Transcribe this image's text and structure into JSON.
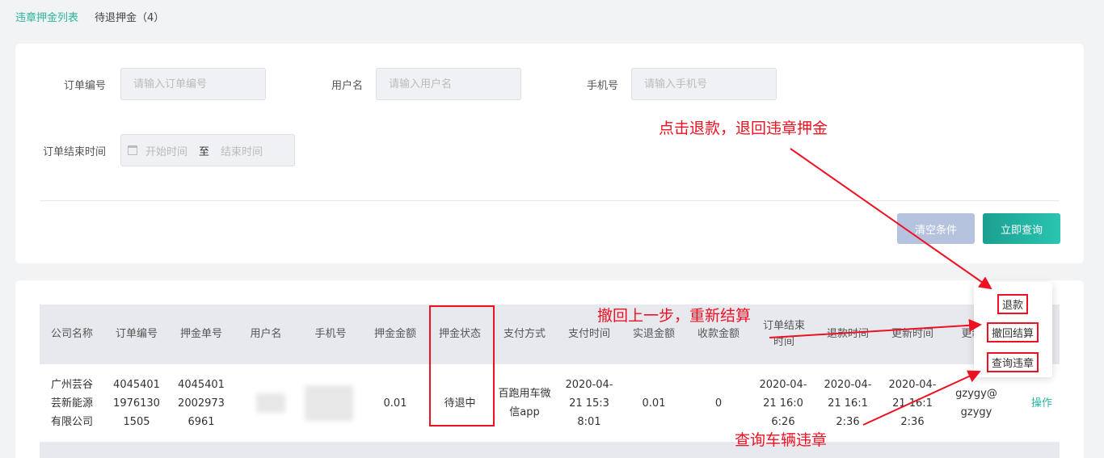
{
  "breadcrumb": {
    "link": "违章押金列表",
    "current": "待退押金（4）"
  },
  "filters": {
    "order_no_label": "订单编号",
    "order_no_placeholder": "请输入订单编号",
    "username_label": "用户名",
    "username_placeholder": "请输入用户名",
    "phone_label": "手机号",
    "phone_placeholder": "请输入手机号",
    "end_time_label": "订单结束时间",
    "start_placeholder": "开始时间",
    "range_sep": "至",
    "end_placeholder": "结束时间",
    "clear_label": "清空条件",
    "query_label": "立即查询"
  },
  "table": {
    "headers": [
      "公司名称",
      "订单编号",
      "押金单号",
      "用户名",
      "手机号",
      "押金金额",
      "押金状态",
      "支付方式",
      "支付时间",
      "实退金额",
      "收款金额",
      "订单结束时间",
      "退款时间",
      "更新时间",
      "更新人"
    ],
    "row": {
      "company": "广州芸谷芸新能源有限公司",
      "order_no": "40454011976130 1505",
      "deposit_no": "40454012002973 6961",
      "amount": "0.01",
      "status": "待退中",
      "pay_method": "百跑用车微信app",
      "pay_time": "2020-04-21 15:38:01",
      "refund_amount": "0.01",
      "received": "0",
      "order_end": "2020-04-21 16:06:26",
      "refund_time": "2020-04-21 16:12:36",
      "update_time": "2020-04-21 16:12:36",
      "updater": "gzygy@gzygy",
      "operation": "操作"
    }
  },
  "popover": {
    "refund": "退款",
    "revoke": "撤回结算",
    "violations": "查询违章"
  },
  "annotations": {
    "refund_note": "点击退款，退回违章押金",
    "revoke_note": "撤回上一步，重新结算",
    "query_note": "查询车辆违章",
    "color": "#e12"
  },
  "colors": {
    "accent": "#2bb5a0",
    "clear_button": "#b6c3de",
    "annotation": "#e12"
  }
}
